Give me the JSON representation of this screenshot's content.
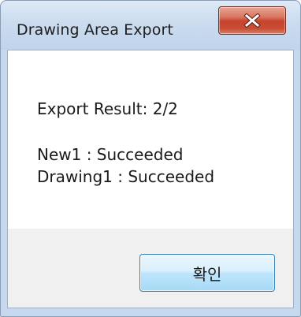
{
  "window": {
    "title": "Drawing Area Export"
  },
  "message": {
    "summary": "Export Result: 2/2",
    "results": [
      "New1 : Succeeded",
      "Drawing1 : Succeeded"
    ]
  },
  "buttons": {
    "ok_label": "확인",
    "close_icon": "close-icon"
  },
  "colors": {
    "close_button": "#c7432c",
    "ok_button_border": "#3c7fb1",
    "footer_bg": "#f0f0f0",
    "frame_bg": "#c5d8ee"
  }
}
